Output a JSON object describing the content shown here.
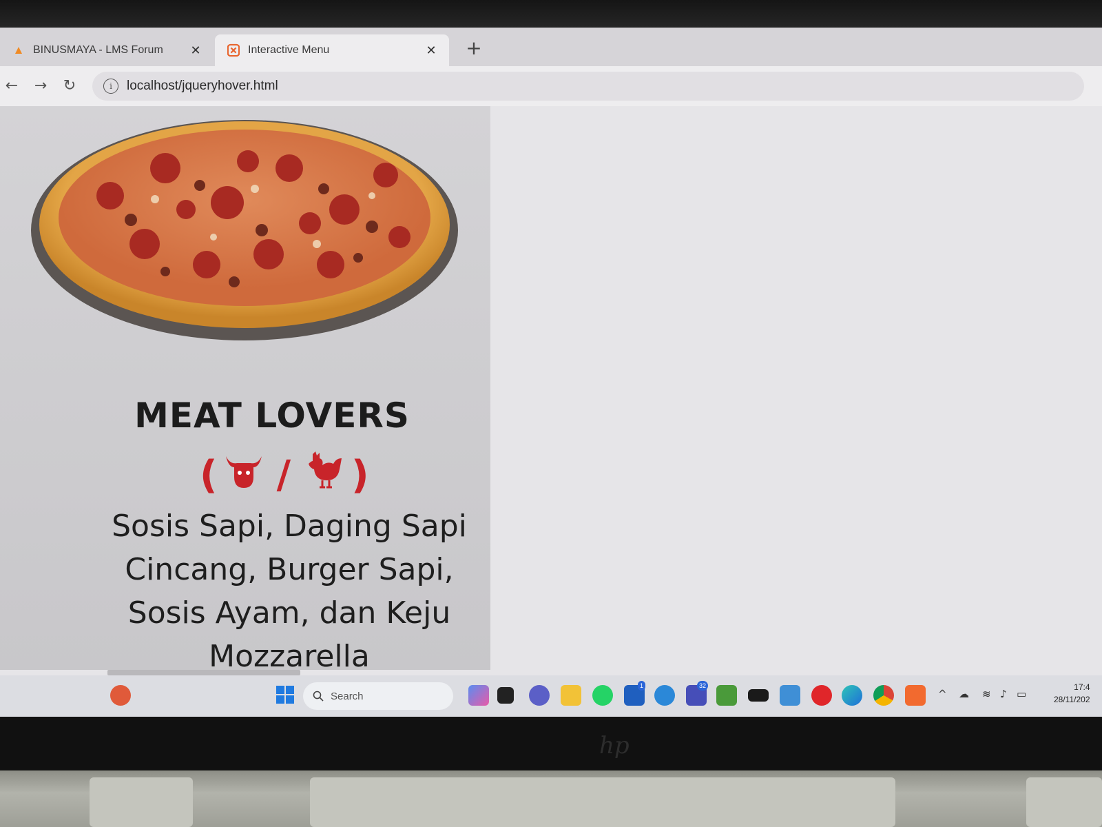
{
  "browser": {
    "tabs": [
      {
        "title": "BINUSMAYA - LMS Forum",
        "active": false
      },
      {
        "title": "Interactive Menu",
        "active": true
      }
    ],
    "url": "localhost/jqueryhover.html"
  },
  "menu_item": {
    "title": "MEAT LOVERS",
    "tags": {
      "open": "(",
      "separator": "/",
      "close": ")"
    },
    "description": "Sosis Sapi, Daging Sapi Cincang, Burger Sapi, Sosis Ayam, dan Keju Mozzarella"
  },
  "taskbar": {
    "search_placeholder": "Search",
    "badges": {
      "store": "1",
      "teams": "32"
    },
    "time": "17:4",
    "date": "28/11/202"
  },
  "colors": {
    "accent_red": "#c8242a"
  }
}
